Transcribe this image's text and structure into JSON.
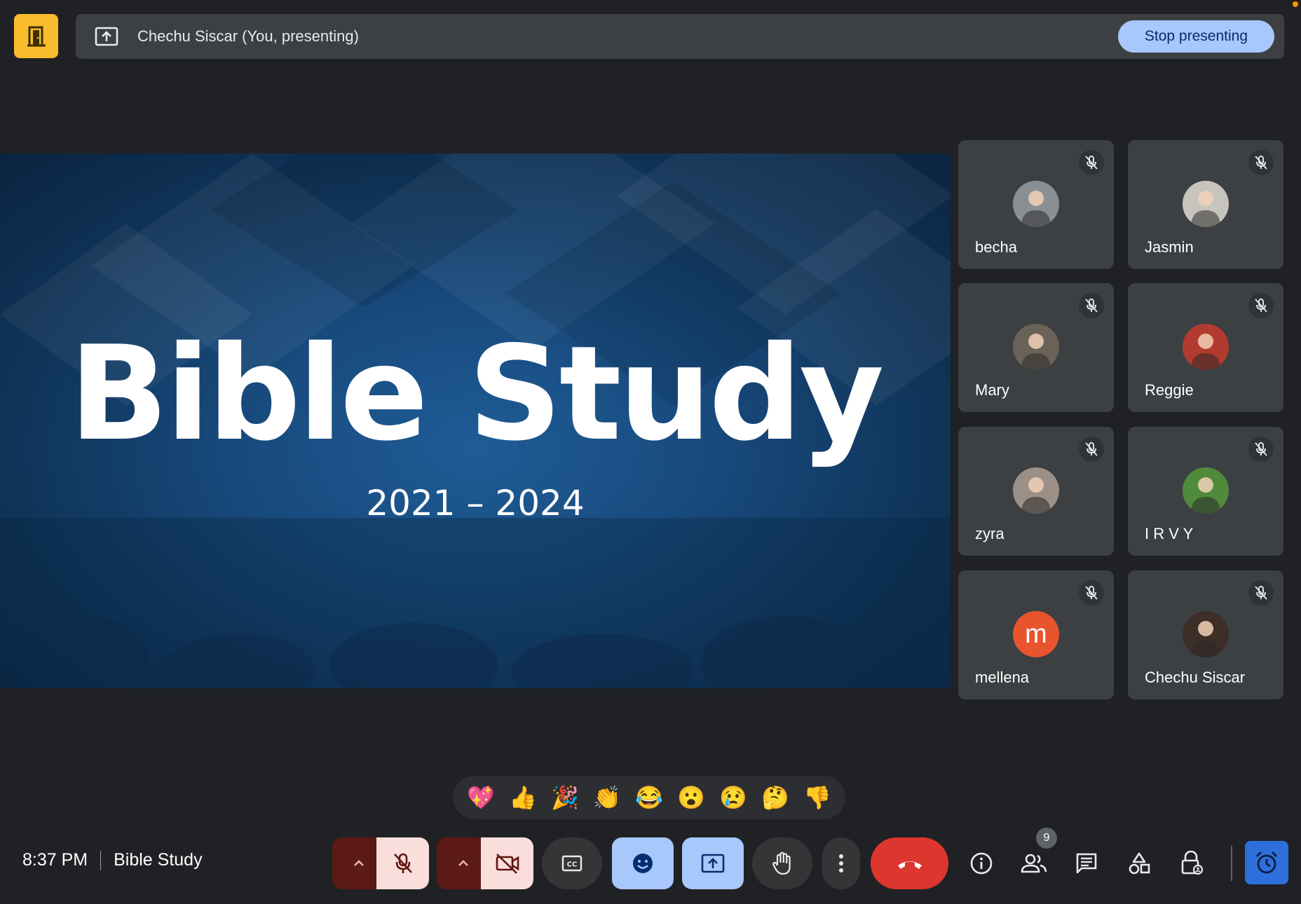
{
  "top_bar": {
    "presenting_text": "Chechu Siscar (You, presenting)",
    "stop_label": "Stop presenting"
  },
  "slide": {
    "title": "Bible Study",
    "years": "2021 – 2024"
  },
  "participants": [
    {
      "name": "becha",
      "muted": true,
      "avatar_color": "#8a8f94"
    },
    {
      "name": "Jasmin",
      "muted": true,
      "avatar_color": "#c7c4bd"
    },
    {
      "name": "Mary",
      "muted": true,
      "avatar_color": "#6b6257"
    },
    {
      "name": "Reggie",
      "muted": true,
      "avatar_color": "#b33a2e"
    },
    {
      "name": "zyra",
      "muted": true,
      "avatar_color": "#9c8f86"
    },
    {
      "name": "I R V Y",
      "muted": true,
      "avatar_color": "#4f8b3a"
    },
    {
      "name": "mellena",
      "muted": true,
      "avatar_letter": "m",
      "avatar_color": "#e8542c"
    },
    {
      "name": "Chechu Siscar",
      "muted": true,
      "avatar_color": "#3e2e28"
    }
  ],
  "reactions": [
    "💖",
    "👍",
    "🎉",
    "👏",
    "😂",
    "😮",
    "😢",
    "🤔",
    "👎"
  ],
  "footer": {
    "time": "8:37 PM",
    "meeting_name": "Bible Study",
    "people_count": "9"
  },
  "colors": {
    "background": "#202124",
    "accent_blue": "#a8c7fa",
    "end_call_red": "#dc362e",
    "meet_yellow": "#f9bc2c"
  }
}
